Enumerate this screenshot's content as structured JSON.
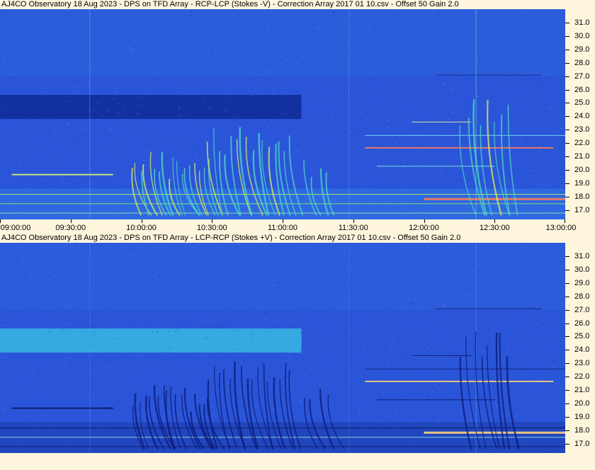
{
  "chart_data": [
    {
      "type": "heatmap",
      "title": "AJ4CO Observatory 18 Aug 2023 -  DPS on TFD Array  -  RCP-LCP (Stokes -V)  -  Correction Array 2017 01 10.csv  -  Offset 50  Gain 2.0",
      "x_ticks": [
        "09:00:00",
        "09:30:00",
        "10:00:00",
        "10:30:00",
        "11:00:00",
        "11:30:00",
        "12:00:00",
        "12:30:00",
        "13:00:00"
      ],
      "y_ticks": [
        "31.0",
        "30.0",
        "29.0",
        "28.0",
        "27.0",
        "26.0",
        "25.0",
        "24.0",
        "23.0",
        "22.0",
        "21.0",
        "20.0",
        "19.0",
        "18.0",
        "17.0"
      ],
      "xlim": [
        "09:00:00",
        "13:00:00"
      ],
      "ylim": [
        16.3,
        32.0
      ],
      "colors": {
        "background": "#2a55d8",
        "dark_band": "#0f2a98",
        "emission": "#4fd8c8",
        "hot": "#ff7b5a"
      }
    },
    {
      "type": "heatmap",
      "title": "AJ4CO Observatory 18 Aug 2023 -  DPS on TFD Array  -  LCP-RCP (Stokes +V)  -  Correction Array 2017 01 10.csv  -  Offset 50  Gain 2.0",
      "y_ticks": [
        "31.0",
        "30.0",
        "29.0",
        "28.0",
        "27.0",
        "26.0",
        "25.0",
        "24.0",
        "23.0",
        "22.0",
        "21.0",
        "20.0",
        "19.0",
        "18.0",
        "17.0"
      ],
      "xlim": [
        "09:00:00",
        "13:00:00"
      ],
      "ylim": [
        16.3,
        32.0
      ],
      "colors": {
        "background": "#2a55d8",
        "bright_band": "#3ac6e6",
        "emission": "#0b1a78",
        "hot": "#ffd27a"
      }
    }
  ]
}
